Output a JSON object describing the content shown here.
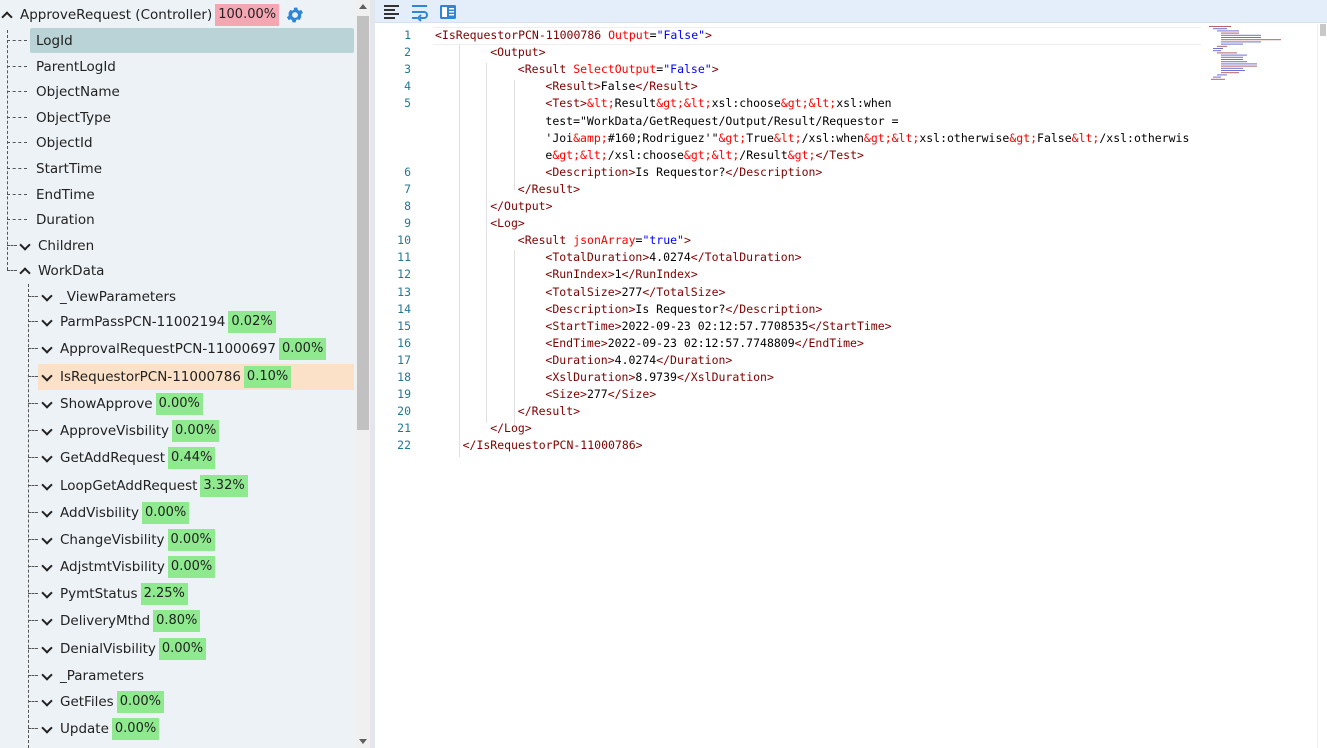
{
  "tree": {
    "root": {
      "label": "ApproveRequest (Controller)",
      "badge": "100.00%"
    },
    "fields": [
      "LogId",
      "ParentLogId",
      "ObjectName",
      "ObjectType",
      "ObjectId",
      "StartTime",
      "EndTime",
      "Duration"
    ],
    "children_label": "Children",
    "workdata_label": "WorkData",
    "workdata_items": [
      {
        "label": "_ViewParameters",
        "badge": ""
      },
      {
        "label": "ParmPassPCN-11002194",
        "badge": "0.02%"
      },
      {
        "label": "ApprovalRequestPCN-11000697",
        "badge": "0.00%"
      },
      {
        "label": "IsRequestorPCN-11000786",
        "badge": "0.10%"
      },
      {
        "label": "ShowApprove",
        "badge": "0.00%"
      },
      {
        "label": "ApproveVisbility",
        "badge": "0.00%"
      },
      {
        "label": "GetAddRequest",
        "badge": "0.44%"
      },
      {
        "label": "LoopGetAddRequest",
        "badge": "3.32%"
      },
      {
        "label": "AddVisbility",
        "badge": "0.00%"
      },
      {
        "label": "ChangeVisbility",
        "badge": "0.00%"
      },
      {
        "label": "AdjstmtVisbility",
        "badge": "0.00%"
      },
      {
        "label": "PymtStatus",
        "badge": "2.25%"
      },
      {
        "label": "DeliveryMthd",
        "badge": "0.80%"
      },
      {
        "label": "DenialVisbility",
        "badge": "0.00%"
      },
      {
        "label": "_Parameters",
        "badge": ""
      },
      {
        "label": "GetFiles",
        "badge": "0.00%"
      },
      {
        "label": "Update",
        "badge": "0.00%"
      }
    ],
    "selected_item": "LogId",
    "highlighted_item": "IsRequestorPCN-11000786"
  },
  "toolbar": {
    "icons": [
      "format-icon",
      "word-wrap-icon",
      "panel-icon"
    ]
  },
  "colors": {
    "tree_bg": "#edf2f6",
    "selected_bg": "#b9d3d6",
    "highlight_bg": "#fbe1c7",
    "badge_green": "#8fea8f",
    "badge_red": "#f4a7b3",
    "xml_tag": "#800000",
    "xml_attr": "#ff0000",
    "xml_value": "#0000ff",
    "line_number": "#237893"
  },
  "editor": {
    "lines": [
      {
        "n": "1",
        "indent": 0,
        "parts": [
          [
            "tag",
            "<IsRequestorPCN-11000786 "
          ],
          [
            "attr",
            "Output"
          ],
          [
            "txt",
            "="
          ],
          [
            "val",
            "\"False\""
          ],
          [
            "tag",
            ">"
          ]
        ]
      },
      {
        "n": "2",
        "indent": 2,
        "parts": [
          [
            "tag",
            "<Output>"
          ]
        ]
      },
      {
        "n": "3",
        "indent": 3,
        "parts": [
          [
            "tag",
            "<Result "
          ],
          [
            "attr",
            "SelectOutput"
          ],
          [
            "txt",
            "="
          ],
          [
            "val",
            "\"False\""
          ],
          [
            "tag",
            ">"
          ]
        ]
      },
      {
        "n": "4",
        "indent": 4,
        "parts": [
          [
            "tag",
            "<Result>"
          ],
          [
            "txt",
            "False"
          ],
          [
            "tag",
            "</Result>"
          ]
        ]
      },
      {
        "n": "5",
        "indent": 4,
        "parts": [
          [
            "tag",
            "<Test>"
          ],
          [
            "ent",
            "&lt;"
          ],
          [
            "txt",
            "Result"
          ],
          [
            "ent",
            "&gt;&lt;"
          ],
          [
            "txt",
            "xsl:choose"
          ],
          [
            "ent",
            "&gt;&lt;"
          ],
          [
            "txt",
            "xsl:when"
          ]
        ]
      },
      {
        "n": "",
        "indent": 4,
        "parts": [
          [
            "txt",
            "test=\"WorkData/GetRequest/Output/Result/Requestor ="
          ]
        ]
      },
      {
        "n": "",
        "indent": 4,
        "parts": [
          [
            "txt",
            "'Joi"
          ],
          [
            "ent",
            "&amp;"
          ],
          [
            "txt",
            "#160;Rodriguez'\""
          ],
          [
            "ent",
            "&gt;"
          ],
          [
            "txt",
            "True"
          ],
          [
            "ent",
            "&lt;"
          ],
          [
            "txt",
            "/xsl:when"
          ],
          [
            "ent",
            "&gt;&lt;"
          ],
          [
            "txt",
            "xsl:otherwise"
          ],
          [
            "ent",
            "&gt;"
          ],
          [
            "txt",
            "False"
          ],
          [
            "ent",
            "&lt;"
          ],
          [
            "txt",
            "/xsl:otherwis"
          ]
        ]
      },
      {
        "n": "",
        "indent": 4,
        "parts": [
          [
            "txt",
            "e"
          ],
          [
            "ent",
            "&gt;&lt;"
          ],
          [
            "txt",
            "/xsl:choose"
          ],
          [
            "ent",
            "&gt;&lt;"
          ],
          [
            "txt",
            "/Result"
          ],
          [
            "ent",
            "&gt;"
          ],
          [
            "tag",
            "</Test>"
          ]
        ]
      },
      {
        "n": "6",
        "indent": 4,
        "parts": [
          [
            "tag",
            "<Description>"
          ],
          [
            "txt",
            "Is Requestor?"
          ],
          [
            "tag",
            "</Description>"
          ]
        ]
      },
      {
        "n": "7",
        "indent": 3,
        "parts": [
          [
            "tag",
            "</Result>"
          ]
        ]
      },
      {
        "n": "8",
        "indent": 2,
        "parts": [
          [
            "tag",
            "</Output>"
          ]
        ]
      },
      {
        "n": "9",
        "indent": 2,
        "parts": [
          [
            "tag",
            "<Log>"
          ]
        ]
      },
      {
        "n": "10",
        "indent": 3,
        "parts": [
          [
            "tag",
            "<Result "
          ],
          [
            "attr",
            "jsonArray"
          ],
          [
            "txt",
            "="
          ],
          [
            "val",
            "\"true\""
          ],
          [
            "tag",
            ">"
          ]
        ]
      },
      {
        "n": "11",
        "indent": 4,
        "parts": [
          [
            "tag",
            "<TotalDuration>"
          ],
          [
            "txt",
            "4.0274"
          ],
          [
            "tag",
            "</TotalDuration>"
          ]
        ]
      },
      {
        "n": "12",
        "indent": 4,
        "parts": [
          [
            "tag",
            "<RunIndex>"
          ],
          [
            "txt",
            "1"
          ],
          [
            "tag",
            "</RunIndex>"
          ]
        ]
      },
      {
        "n": "13",
        "indent": 4,
        "parts": [
          [
            "tag",
            "<TotalSize>"
          ],
          [
            "txt",
            "277"
          ],
          [
            "tag",
            "</TotalSize>"
          ]
        ]
      },
      {
        "n": "14",
        "indent": 4,
        "parts": [
          [
            "tag",
            "<Description>"
          ],
          [
            "txt",
            "Is Requestor?"
          ],
          [
            "tag",
            "</Description>"
          ]
        ]
      },
      {
        "n": "15",
        "indent": 4,
        "parts": [
          [
            "tag",
            "<StartTime>"
          ],
          [
            "txt",
            "2022-09-23 02:12:57.7708535"
          ],
          [
            "tag",
            "</StartTime>"
          ]
        ]
      },
      {
        "n": "16",
        "indent": 4,
        "parts": [
          [
            "tag",
            "<EndTime>"
          ],
          [
            "txt",
            "2022-09-23 02:12:57.7748809"
          ],
          [
            "tag",
            "</EndTime>"
          ]
        ]
      },
      {
        "n": "17",
        "indent": 4,
        "parts": [
          [
            "tag",
            "<Duration>"
          ],
          [
            "txt",
            "4.0274"
          ],
          [
            "tag",
            "</Duration>"
          ]
        ]
      },
      {
        "n": "18",
        "indent": 4,
        "parts": [
          [
            "tag",
            "<XslDuration>"
          ],
          [
            "txt",
            "8.9739"
          ],
          [
            "tag",
            "</XslDuration>"
          ]
        ]
      },
      {
        "n": "19",
        "indent": 4,
        "parts": [
          [
            "tag",
            "<Size>"
          ],
          [
            "txt",
            "277"
          ],
          [
            "tag",
            "</Size>"
          ]
        ]
      },
      {
        "n": "20",
        "indent": 3,
        "parts": [
          [
            "tag",
            "</Result>"
          ]
        ]
      },
      {
        "n": "21",
        "indent": 2,
        "parts": [
          [
            "tag",
            "</Log>"
          ]
        ]
      },
      {
        "n": "22",
        "indent": 1,
        "parts": [
          [
            "tag",
            "</IsRequestorPCN-11000786>"
          ]
        ]
      }
    ]
  }
}
